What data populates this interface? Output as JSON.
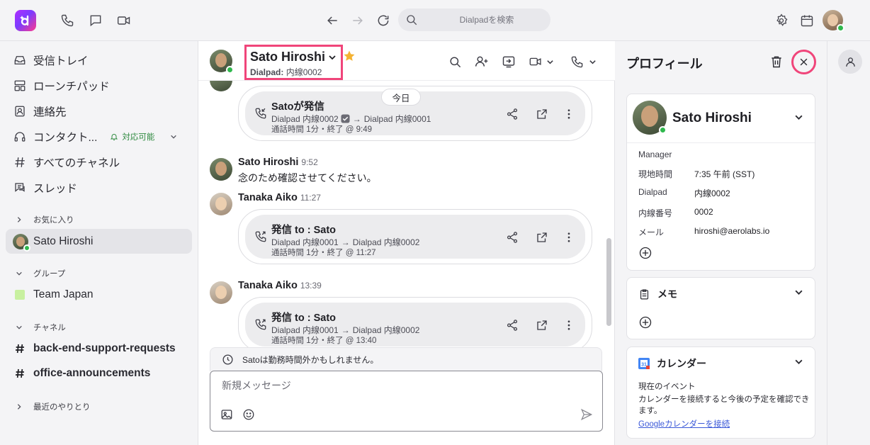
{
  "topbar": {
    "search_placeholder": "Dialpadを検索"
  },
  "sidebar": {
    "items": [
      {
        "label": "受信トレイ"
      },
      {
        "label": "ローンチパッド"
      },
      {
        "label": "連絡先"
      },
      {
        "label": "コンタクト...",
        "status": "対応可能"
      },
      {
        "label": "すべてのチャネル"
      },
      {
        "label": "スレッド"
      }
    ],
    "favorites_head": "お気に入り",
    "favorites": [
      {
        "label": "Sato Hiroshi"
      }
    ],
    "groups_head": "グループ",
    "groups": [
      {
        "label": "Team Japan"
      }
    ],
    "channels_head": "チャネル",
    "channels": [
      {
        "label": "back-end-support-requests"
      },
      {
        "label": "office-announcements"
      }
    ],
    "recent_head": "最近のやりとり"
  },
  "chat": {
    "title": "Sato Hiroshi",
    "sub_prefix": "Dialpad:",
    "sub_value": "内線0002",
    "date_pill": "今日",
    "calls": [
      {
        "title": "Satoが発信",
        "from": "Dialpad 内線0002",
        "to": "Dialpad 内線0001",
        "duration": "通話時間 1分・終了 @ 9:49"
      },
      {
        "title": "発信 to : Sato",
        "from": "Dialpad 内線0001",
        "to": "Dialpad 内線0002",
        "duration": "通話時間 1分・終了 @ 11:27"
      },
      {
        "title": "発信 to : Sato",
        "from": "Dialpad 内線0001",
        "to": "Dialpad 内線0002",
        "duration": "通話時間 1分・終了 @ 13:40"
      }
    ],
    "messages": [
      {
        "name": "Sato Hiroshi",
        "time": "9:52",
        "text": "念のため確認させてください。"
      },
      {
        "name": "Tanaka Aiko",
        "time": "11:27"
      },
      {
        "name": "Tanaka Aiko",
        "time": "13:39"
      }
    ],
    "ooo_notice": "Satoは勤務時間外かもしれません。",
    "composer_placeholder": "新規メッセージ"
  },
  "profile": {
    "title": "プロフィール",
    "name": "Sato Hiroshi",
    "role": "Manager",
    "fields": [
      {
        "key": "現地時間",
        "value": "7:35 午前 (SST)"
      },
      {
        "key": "Dialpad",
        "value": "内線0002"
      },
      {
        "key": "内線番号",
        "value": "0002"
      },
      {
        "key": "メール",
        "value": "hiroshi@aerolabs.io"
      }
    ],
    "memo_head": "メモ",
    "calendar_head": "カレンダー",
    "calendar_current": "現在のイベント",
    "calendar_desc": "カレンダーを接続すると今後の予定を確認できます。",
    "calendar_link": "Googleカレンダーを接続"
  },
  "colors": {
    "accent_highlight": "#f0457a",
    "presence_green": "#2fb84d",
    "brand_purple": "#7b3cff",
    "link_blue": "#3a58d8"
  }
}
